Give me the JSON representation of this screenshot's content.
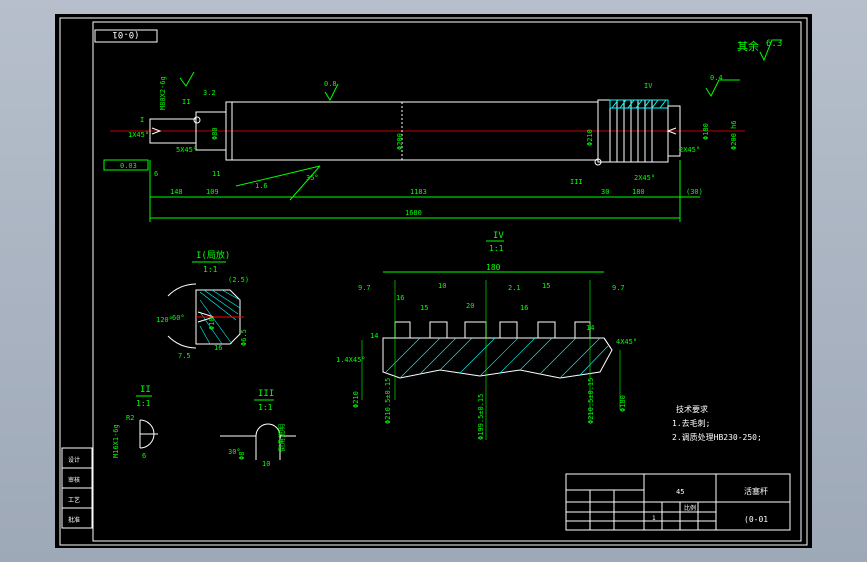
{
  "drawing_code_box": "(0-01",
  "roughness_note": "其余",
  "roughness_value": "6.3",
  "shaft_labels": {
    "detail_I": "I",
    "detail_II": "II",
    "detail_III": "III",
    "detail_IV": "IV",
    "thread_left": "M80X2-6g",
    "chamfer_left": "1X45°",
    "chamfer_small": "5X45°",
    "runout": "0.03",
    "tol_phi": "Φ80",
    "tol_main": "Φ200",
    "tol_right_phi": "Φ210",
    "chamfer_right": "2X45°",
    "right_dia": "Φ200 h6",
    "right_phi": "Φ180",
    "roughness_top": "0.8",
    "roughness_right": "0.4",
    "roughness_left": "3.2",
    "roughness_mid": "1.6",
    "angle_35": "35°",
    "dim_6": "6",
    "dim_11": "11",
    "dim_148": "148",
    "dim_109": "109",
    "dim_1183": "1183",
    "dim_30": "30",
    "dim_180": "180",
    "dim_30b": "(30)",
    "dim_1680": "1680"
  },
  "detail_IV": {
    "title": "IV",
    "scale": "1:1",
    "total": "180",
    "dims": [
      "9.7",
      "16",
      "10",
      "15",
      "20",
      "2.1",
      "15",
      "9.7",
      "14",
      "14",
      "16"
    ],
    "phi_labels": [
      "Φ210",
      "Φ210.5±0.15",
      "Φ199.5±0.15",
      "Φ210.5±0.15",
      "Φ180"
    ],
    "chamfer": "1.4X45°",
    "chamfer_r": "4X45°"
  },
  "detail_I": {
    "title": "I(局放)",
    "scale": "1:1",
    "dims": [
      "(2.5)",
      "120°",
      "60°",
      "Φ10",
      "16",
      "7.5",
      "Φ6.5"
    ]
  },
  "detail_II": {
    "title": "II",
    "scale": "1:1",
    "dims": [
      "R2",
      "M16X1-6g",
      "6"
    ]
  },
  "detail_III": {
    "title": "III",
    "scale": "1:1",
    "dims": [
      "30°",
      "Φ8",
      "10",
      "倒角说明"
    ]
  },
  "tech_notes": {
    "heading": "技术要求",
    "items": [
      "1.去毛刺;",
      "2.调质处理HB230-250;"
    ]
  },
  "title_block": {
    "part_name": "活塞杆",
    "drawing_no": "(0-01",
    "scale_label": "比例",
    "material": "45",
    "qty": "1",
    "left_labels": [
      "设计",
      "审核",
      "工艺",
      "批准"
    ]
  },
  "colors": {
    "background": "#000000",
    "frame": "#ffffff",
    "geometry": "#ffffff",
    "dimension": "#00ff00",
    "text_yellow": "#ffff00",
    "center_line": "#ff0000",
    "hatch": "#00ffff"
  }
}
